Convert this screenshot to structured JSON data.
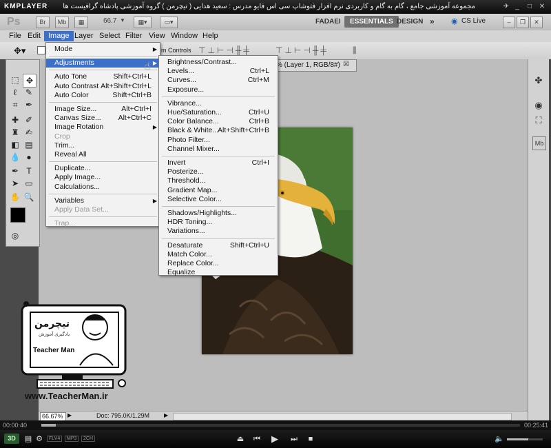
{
  "km": {
    "logo": "KMPLAYER",
    "caption": "مجموعه آموزشی جامع ، گام به گام و کاربردی نرم افزار فتوشاپ سی اس فایو  مدرس : سعید هدایی ( تیچرمن ) گروه آموزشی پادشاه گرافیست ها",
    "time_elapsed": "00:00:40",
    "time_total": "00:25:41",
    "badges": [
      "FLV4",
      "MP3",
      "2CH"
    ],
    "btn_3d": "3D"
  },
  "ps": {
    "logo": "Ps",
    "bridge": "Br",
    "mini_bridge": "Mb",
    "zoom": "66.7",
    "workspaces": [
      "FADAEI",
      "ESSENTIALS",
      "DESIGN"
    ],
    "cs_live": "CS Live",
    "menubar": [
      "File",
      "Edit",
      "Image",
      "Layer",
      "Select",
      "Filter",
      "View",
      "Window",
      "Help"
    ],
    "options_text": "m Controls",
    "doc_tab": "% (Layer 1, RGB/8#)",
    "status_zoom": "66.67%",
    "status_doc": "Doc: 795.0K/1.29M"
  },
  "image_menu": [
    {
      "label": "Mode",
      "arrow": true
    },
    {
      "sep": true
    },
    {
      "label": "Adjustments",
      "arrow": true,
      "highlight": true
    },
    {
      "sep": true
    },
    {
      "label": "Auto Tone",
      "shortcut": "Shift+Ctrl+L"
    },
    {
      "label": "Auto Contrast",
      "shortcut": "Alt+Shift+Ctrl+L"
    },
    {
      "label": "Auto Color",
      "shortcut": "Shift+Ctrl+B"
    },
    {
      "sep": true
    },
    {
      "label": "Image Size...",
      "shortcut": "Alt+Ctrl+I"
    },
    {
      "label": "Canvas Size...",
      "shortcut": "Alt+Ctrl+C"
    },
    {
      "label": "Image Rotation",
      "arrow": true
    },
    {
      "label": "Crop",
      "disabled": true
    },
    {
      "label": "Trim..."
    },
    {
      "label": "Reveal All"
    },
    {
      "sep": true
    },
    {
      "label": "Duplicate..."
    },
    {
      "label": "Apply Image..."
    },
    {
      "label": "Calculations..."
    },
    {
      "sep": true
    },
    {
      "label": "Variables",
      "arrow": true
    },
    {
      "label": "Apply Data Set...",
      "disabled": true
    },
    {
      "sep": true
    },
    {
      "label": "Trap...",
      "disabled": true
    }
  ],
  "adjust_menu": [
    {
      "label": "Brightness/Contrast..."
    },
    {
      "label": "Levels...",
      "shortcut": "Ctrl+L"
    },
    {
      "label": "Curves...",
      "shortcut": "Ctrl+M"
    },
    {
      "label": "Exposure..."
    },
    {
      "sep": true
    },
    {
      "label": "Vibrance..."
    },
    {
      "label": "Hue/Saturation...",
      "shortcut": "Ctrl+U"
    },
    {
      "label": "Color Balance...",
      "shortcut": "Ctrl+B"
    },
    {
      "label": "Black & White...",
      "shortcut": "Alt+Shift+Ctrl+B"
    },
    {
      "label": "Photo Filter..."
    },
    {
      "label": "Channel Mixer..."
    },
    {
      "sep": true
    },
    {
      "label": "Invert",
      "shortcut": "Ctrl+I"
    },
    {
      "label": "Posterize..."
    },
    {
      "label": "Threshold..."
    },
    {
      "label": "Gradient Map..."
    },
    {
      "label": "Selective Color..."
    },
    {
      "sep": true
    },
    {
      "label": "Shadows/Highlights..."
    },
    {
      "label": "HDR Toning..."
    },
    {
      "label": "Variations..."
    },
    {
      "sep": true
    },
    {
      "label": "Desaturate",
      "shortcut": "Shift+Ctrl+U"
    },
    {
      "label": "Match Color..."
    },
    {
      "label": "Replace Color..."
    },
    {
      "label": "Equalize"
    }
  ],
  "watermark": {
    "logo_fa": "تیچرمن",
    "tagline_fa": "یادگیری آموزش",
    "name": "Teacher Man",
    "site": "www.TeacherMan.ir"
  },
  "colors": {
    "highlight": "#3b6fc8",
    "workspace_bg": "#bdbdbd",
    "panel_bg": "#d2d2d2"
  }
}
